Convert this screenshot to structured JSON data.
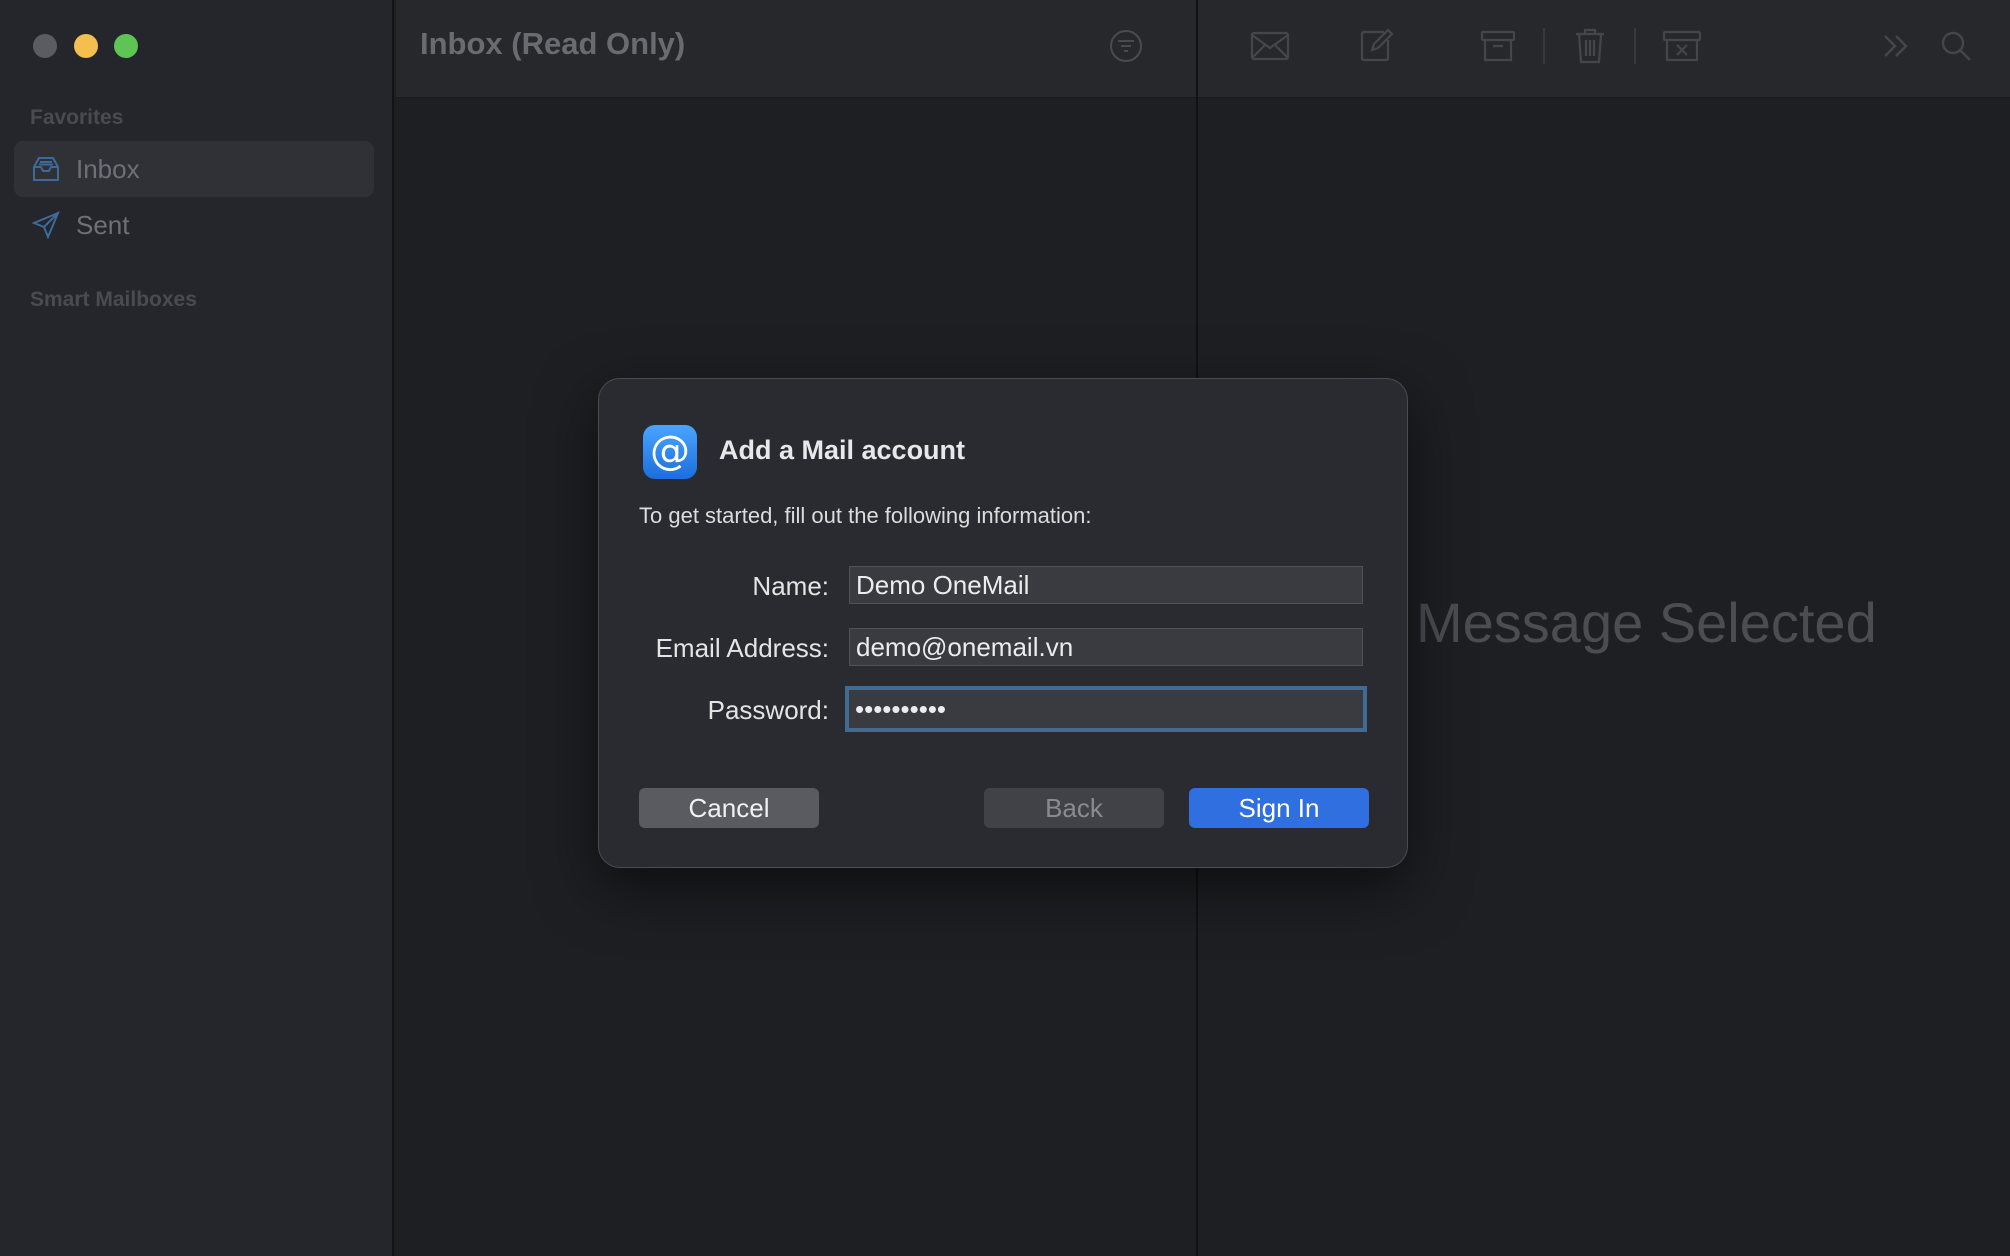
{
  "window": {
    "controls": [
      "close",
      "minimize",
      "maximize"
    ]
  },
  "sidebar": {
    "favorites_header": "Favorites",
    "items": [
      {
        "label": "Inbox",
        "icon": "inbox-icon",
        "selected": true
      },
      {
        "label": "Sent",
        "icon": "paper-plane-icon",
        "selected": false
      }
    ],
    "smart_mailboxes_header": "Smart Mailboxes"
  },
  "message_list": {
    "title": "Inbox (Read Only)",
    "filter_icon": "filter-icon"
  },
  "toolbar": {
    "icons": [
      "envelope-icon",
      "compose-icon",
      "archive-icon",
      "trash-icon",
      "junk-icon",
      "more-chevrons-icon",
      "search-icon"
    ]
  },
  "reading_pane": {
    "empty_text": "Message Selected"
  },
  "dialog": {
    "title": "Add a Mail account",
    "app_icon": "@",
    "subtitle": "To get started, fill out the following information:",
    "fields": {
      "name": {
        "label": "Name:",
        "value": "Demo OneMail"
      },
      "email": {
        "label": "Email Address:",
        "value": "demo@onemail.vn"
      },
      "password": {
        "label": "Password:",
        "value": "••••••••••"
      }
    },
    "buttons": {
      "cancel": "Cancel",
      "back": "Back",
      "sign_in": "Sign In"
    }
  },
  "colors": {
    "accent": "#2f6fe0",
    "focus_ring": "#3f6b94",
    "close": "#5b5c61",
    "minimize": "#f5bf4f",
    "maximize": "#5ec454"
  }
}
